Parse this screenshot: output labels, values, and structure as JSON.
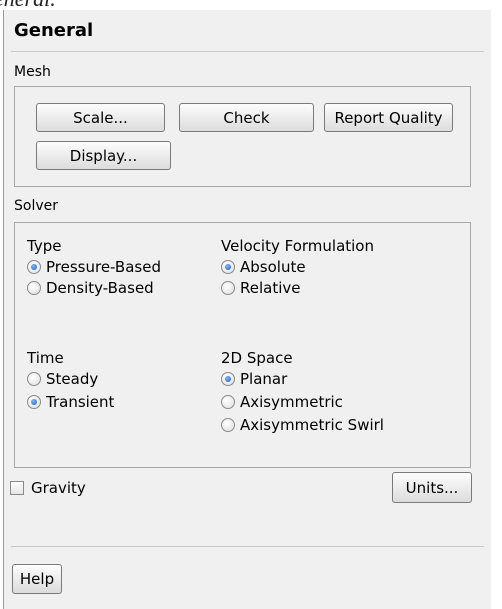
{
  "caption": "eneral.",
  "panel": {
    "title": "General",
    "mesh": {
      "label": "Mesh",
      "buttons": {
        "scale": "Scale...",
        "check": "Check",
        "report_quality": "Report Quality",
        "display": "Display..."
      }
    },
    "solver": {
      "label": "Solver",
      "type": {
        "heading": "Type",
        "options": [
          "Pressure-Based",
          "Density-Based"
        ],
        "selected": "Pressure-Based"
      },
      "velocity_formulation": {
        "heading": "Velocity Formulation",
        "options": [
          "Absolute",
          "Relative"
        ],
        "selected": "Absolute"
      },
      "time": {
        "heading": "Time",
        "options": [
          "Steady",
          "Transient"
        ],
        "selected": "Transient"
      },
      "space_2d": {
        "heading": "2D Space",
        "options": [
          "Planar",
          "Axisymmetric",
          "Axisymmetric Swirl"
        ],
        "selected": "Planar"
      }
    },
    "gravity": {
      "label": "Gravity",
      "checked": false
    },
    "units_button": "Units...",
    "help_button": "Help"
  },
  "colors": {
    "panel_bg": "#f0f0f0",
    "radio_selected": "#1e5fbf",
    "border": "#a8a8a8"
  }
}
